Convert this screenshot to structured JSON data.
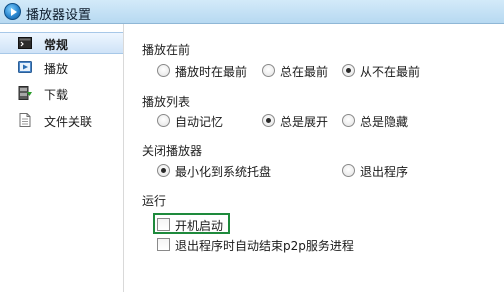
{
  "window": {
    "title": "播放器设置"
  },
  "sidebar": {
    "items": [
      {
        "label": "常规",
        "icon": "terminal-icon",
        "active": true
      },
      {
        "label": "播放",
        "icon": "play-icon",
        "active": false
      },
      {
        "label": "下载",
        "icon": "download-icon",
        "active": false
      },
      {
        "label": "文件关联",
        "icon": "document-icon",
        "active": false
      }
    ]
  },
  "sections": {
    "play_on_top": {
      "title": "播放在前",
      "options": [
        "播放时在最前",
        "总在最前",
        "从不在最前"
      ],
      "selected": "从不在最前"
    },
    "playlist": {
      "title": "播放列表",
      "options": [
        "自动记忆",
        "总是展开",
        "总是隐藏"
      ],
      "selected": "总是展开"
    },
    "close_player": {
      "title": "关闭播放器",
      "options": [
        "最小化到系统托盘",
        "退出程序"
      ],
      "selected": "最小化到系统托盘"
    },
    "run": {
      "title": "运行",
      "checkboxes": [
        {
          "label": "开机启动",
          "checked": false
        },
        {
          "label": "退出程序时自动结束p2p服务进程",
          "checked": false
        }
      ]
    }
  },
  "colors": {
    "titlebar": "#c4e1f5",
    "highlight_border": "#1e8a3c"
  }
}
